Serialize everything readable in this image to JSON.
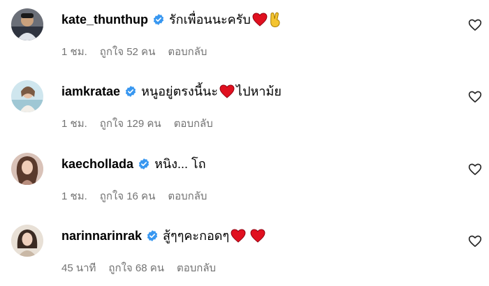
{
  "colors": {
    "accent_verified": "#3897f0",
    "meta_text": "#737373",
    "heart_red": "#e0101f"
  },
  "comments": [
    {
      "username": "kate_thunthup",
      "text": "รักเพื่อนนะครับ",
      "emojis": [
        "red-heart",
        "victory-hand"
      ],
      "time": "1 ชม.",
      "likes": "ถูกใจ 52 คน",
      "reply": "ตอบกลับ"
    },
    {
      "username": "iamkratae",
      "text_before": "หนูอยู่ตรงนี้นะ",
      "text_after": "ไปหาม้ย",
      "emojis": [
        "red-heart"
      ],
      "time": "1 ชม.",
      "likes": "ถูกใจ 129 คน",
      "reply": "ตอบกลับ"
    },
    {
      "username": "kaechollada",
      "text": "หนิง... โถ",
      "emojis": [],
      "time": "1 ชม.",
      "likes": "ถูกใจ 16 คน",
      "reply": "ตอบกลับ"
    },
    {
      "username": "narinnarinrak",
      "text": "สู้ๆๆคะกอดๆ",
      "emojis": [
        "red-heart",
        "red-heart"
      ],
      "time": "45 นาที",
      "likes": "ถูกใจ 68 คน",
      "reply": "ตอบกลับ"
    }
  ]
}
